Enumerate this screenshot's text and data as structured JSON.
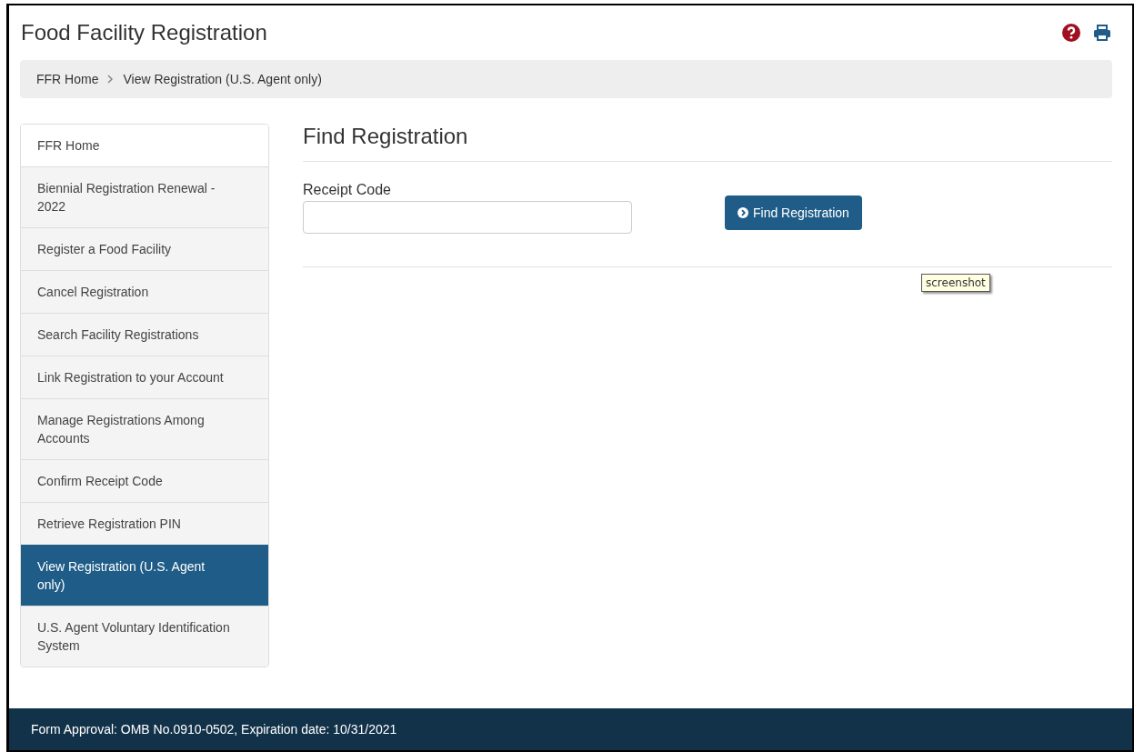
{
  "header": {
    "title": "Food Facility Registration"
  },
  "breadcrumb": [
    {
      "label": "FFR Home"
    },
    {
      "label": "View Registration (U.S. Agent only)"
    }
  ],
  "sidebar": {
    "items": [
      {
        "label": "FFR Home",
        "selected": false
      },
      {
        "label": "Biennial Registration Renewal - 2022",
        "selected": false
      },
      {
        "label": "Register a Food Facility",
        "selected": false
      },
      {
        "label": "Cancel Registration",
        "selected": false
      },
      {
        "label": "Search Facility Registrations",
        "selected": false
      },
      {
        "label": "Link Registration to your Account",
        "selected": false
      },
      {
        "label": "Manage Registrations Among Accounts",
        "selected": false
      },
      {
        "label": "Confirm Receipt Code",
        "selected": false
      },
      {
        "label": "Retrieve Registration PIN",
        "selected": false
      },
      {
        "label": "View Registration (U.S. Agent only)",
        "selected": true
      },
      {
        "label": "U.S. Agent Voluntary Identification System",
        "selected": false
      }
    ]
  },
  "main": {
    "heading": "Find Registration",
    "field": {
      "label": "Receipt Code"
    },
    "button": "Find Registration",
    "tooltip": "screenshot"
  },
  "footer": "Form Approval: OMB No.0910-0502, Expiration date: 10/31/2021"
}
